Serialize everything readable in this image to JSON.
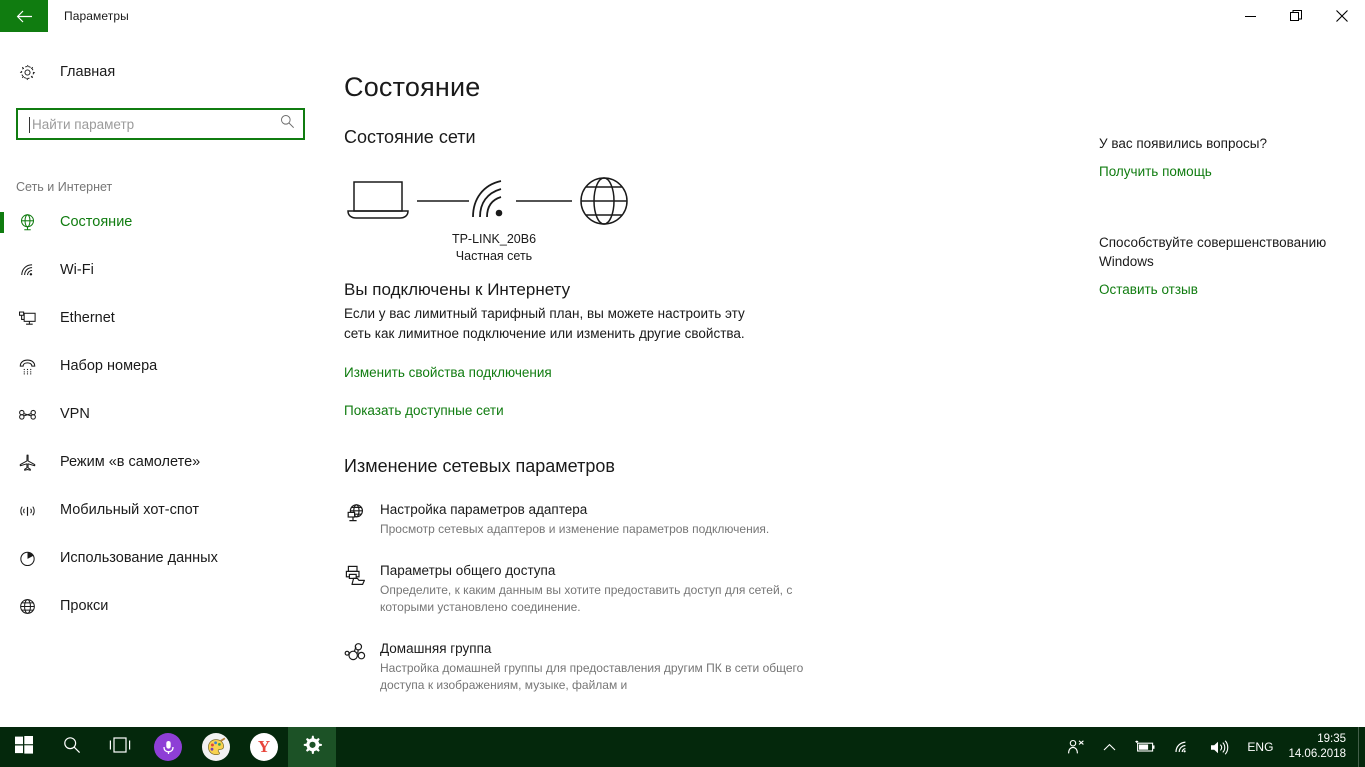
{
  "window": {
    "title": "Параметры",
    "back_icon": "back-arrow-icon",
    "minimize_label": "–",
    "restore_label": "❐",
    "close_label": "✕"
  },
  "sidebar": {
    "home_label": "Главная",
    "home_icon": "gear-icon",
    "search": {
      "placeholder": "Найти параметр",
      "value": "",
      "icon": "search-icon"
    },
    "group_label": "Сеть и Интернет",
    "items": [
      {
        "label": "Состояние",
        "icon": "network-status-icon",
        "selected": true
      },
      {
        "label": "Wi-Fi",
        "icon": "wifi-icon",
        "selected": false
      },
      {
        "label": "Ethernet",
        "icon": "ethernet-icon",
        "selected": false
      },
      {
        "label": "Набор номера",
        "icon": "dialup-phone-icon",
        "selected": false
      },
      {
        "label": "VPN",
        "icon": "vpn-icon",
        "selected": false
      },
      {
        "label": "Режим «в самолете»",
        "icon": "airplane-icon",
        "selected": false
      },
      {
        "label": "Мобильный хот-спот",
        "icon": "hotspot-icon",
        "selected": false
      },
      {
        "label": "Использование данных",
        "icon": "data-usage-pie-icon",
        "selected": false
      },
      {
        "label": "Прокси",
        "icon": "globe-icon",
        "selected": false
      }
    ]
  },
  "main": {
    "page_title": "Состояние",
    "network_status_heading": "Состояние сети",
    "diagram": {
      "device_icon": "laptop-icon",
      "link_icon": "wifi-signal-icon",
      "internet_icon": "globe-icon",
      "network_name": "TP-LINK_20B6",
      "network_type": "Частная сеть"
    },
    "connected_heading": "Вы подключены к Интернету",
    "connected_description": "Если у вас лимитный тарифный план, вы можете настроить эту сеть как лимитное подключение или изменить другие свойства.",
    "link_change_properties": "Изменить свойства подключения",
    "link_show_networks": "Показать доступные сети",
    "change_settings_heading": "Изменение сетевых параметров",
    "options": [
      {
        "icon": "adapter-settings-icon",
        "title": "Настройка параметров адаптера",
        "description": "Просмотр сетевых адаптеров и изменение параметров подключения."
      },
      {
        "icon": "sharing-options-icon",
        "title": "Параметры общего доступа",
        "description": "Определите, к каким данным вы хотите предоставить доступ для сетей, с которыми установлено соединение."
      },
      {
        "icon": "homegroup-icon",
        "title": "Домашняя группа",
        "description": "Настройка домашней группы для предоставления другим ПК в сети общего доступа к изображениям, музыке, файлам и"
      }
    ]
  },
  "help_panel": {
    "questions_heading": "У вас появились вопросы?",
    "get_help_link": "Получить помощь",
    "improve_heading": "Способствуйте совершенствованию Windows",
    "feedback_link": "Оставить отзыв"
  },
  "taskbar": {
    "start_icon": "windows-start-icon",
    "search_icon": "search-icon",
    "taskview_icon": "task-view-icon",
    "cortana_icon": "cortana-mic-icon",
    "paint_icon": "paint-palette-icon",
    "yandex_icon": "yandex-browser-icon",
    "yandex_letter": "Y",
    "settings_icon": "settings-gear-icon",
    "tray": {
      "people_icon": "people-icon",
      "chevron_icon": "chevron-up-icon",
      "battery_icon": "battery-charging-icon",
      "wifi_icon": "wifi-icon",
      "volume_icon": "volume-icon",
      "language": "ENG",
      "time": "19:35",
      "date": "14.06.2018",
      "show_desktop": "show-desktop-button"
    }
  },
  "colors": {
    "accent_green": "#107c10",
    "taskbar": "#04280c",
    "text": "#1a1a1a",
    "muted": "#767676"
  }
}
